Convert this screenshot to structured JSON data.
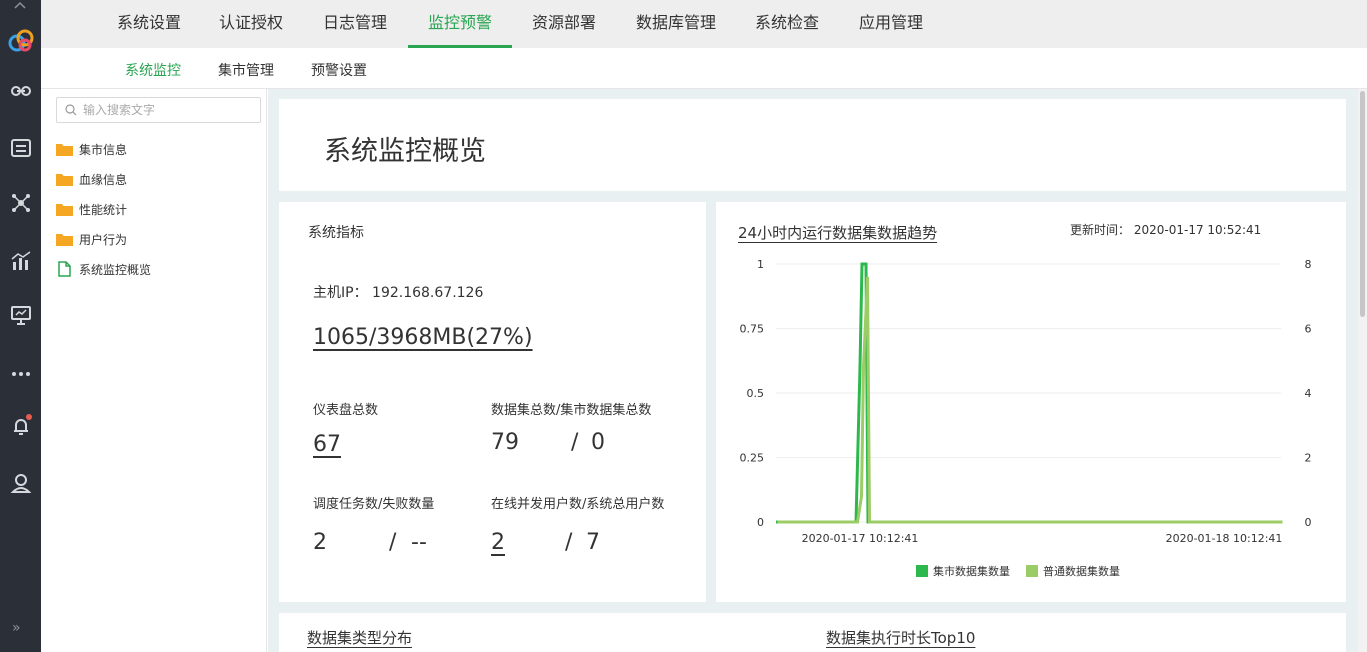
{
  "app": {
    "top_tabs": [
      {
        "label": "系统设置",
        "active": false
      },
      {
        "label": "认证授权",
        "active": false
      },
      {
        "label": "日志管理",
        "active": false
      },
      {
        "label": "监控预警",
        "active": true
      },
      {
        "label": "资源部署",
        "active": false
      },
      {
        "label": "数据库管理",
        "active": false
      },
      {
        "label": "系统检查",
        "active": false
      },
      {
        "label": "应用管理",
        "active": false
      }
    ],
    "sub_tabs": [
      {
        "label": "系统监控",
        "active": true
      },
      {
        "label": "集市管理",
        "active": false
      },
      {
        "label": "预警设置",
        "active": false
      }
    ],
    "accent_color": "#2aa551",
    "rail_icons": [
      "logo-icon",
      "link-icon",
      "list-icon",
      "network-icon",
      "bar-chart-icon",
      "presentation-icon",
      "more-icon",
      "bell-icon",
      "user-icon",
      "expand-icon"
    ]
  },
  "tree": {
    "search_placeholder": "输入搜索文字",
    "items": [
      {
        "label": "集市信息",
        "icon": "folder-icon"
      },
      {
        "label": "血缘信息",
        "icon": "folder-icon"
      },
      {
        "label": "性能统计",
        "icon": "folder-icon"
      },
      {
        "label": "用户行为",
        "icon": "folder-icon"
      },
      {
        "label": "系统监控概览",
        "icon": "file-icon"
      }
    ]
  },
  "page": {
    "title": "系统监控概览"
  },
  "metrics": {
    "heading": "系统指标",
    "host_ip_label": "主机IP：",
    "host_ip": "192.168.67.126",
    "memory": "1065/3968MB(27%)",
    "dashboards_label": "仪表盘总数",
    "dashboards_value": "67",
    "datasets_label": "数据集总数/集市数据集总数",
    "datasets_value": "79",
    "mart_datasets_value": "0",
    "tasks_label": "调度任务数/失败数量",
    "tasks_value": "2",
    "failed_value": "--",
    "users_label": "在线并发用户数/系统总用户数",
    "online_users_value": "2",
    "total_users_value": "7"
  },
  "trend": {
    "title": "24小时内运行数据集数据趋势",
    "update_label": "更新时间：",
    "update_time": "2020-01-17 10:52:41"
  },
  "bottom": {
    "left_title": "数据集类型分布",
    "right_title": "数据集执行时长Top10"
  },
  "chart_data": {
    "type": "line",
    "title": "24小时内运行数据集数据趋势",
    "x_ticks": [
      "2020-01-17 10:12:41",
      "2020-01-18 10:12:41"
    ],
    "y_left_ticks": [
      "1",
      "0.75",
      "0.5",
      "0.25",
      "0"
    ],
    "y_right_ticks": [
      "8",
      "6",
      "4",
      "2",
      "0"
    ],
    "ylim_left": [
      0,
      1
    ],
    "ylim_right": [
      0,
      8
    ],
    "grid": true,
    "legend_position": "bottom",
    "series": [
      {
        "name": "集市数据集数量",
        "color": "#2db84d",
        "axis": "left",
        "values": [
          0,
          0,
          0.6,
          1,
          1,
          0,
          0
        ]
      },
      {
        "name": "普通数据集数量",
        "color": "#9ccc65",
        "axis": "left",
        "values": [
          0,
          0,
          0.1,
          0.6,
          0.95,
          0,
          0
        ]
      }
    ]
  }
}
